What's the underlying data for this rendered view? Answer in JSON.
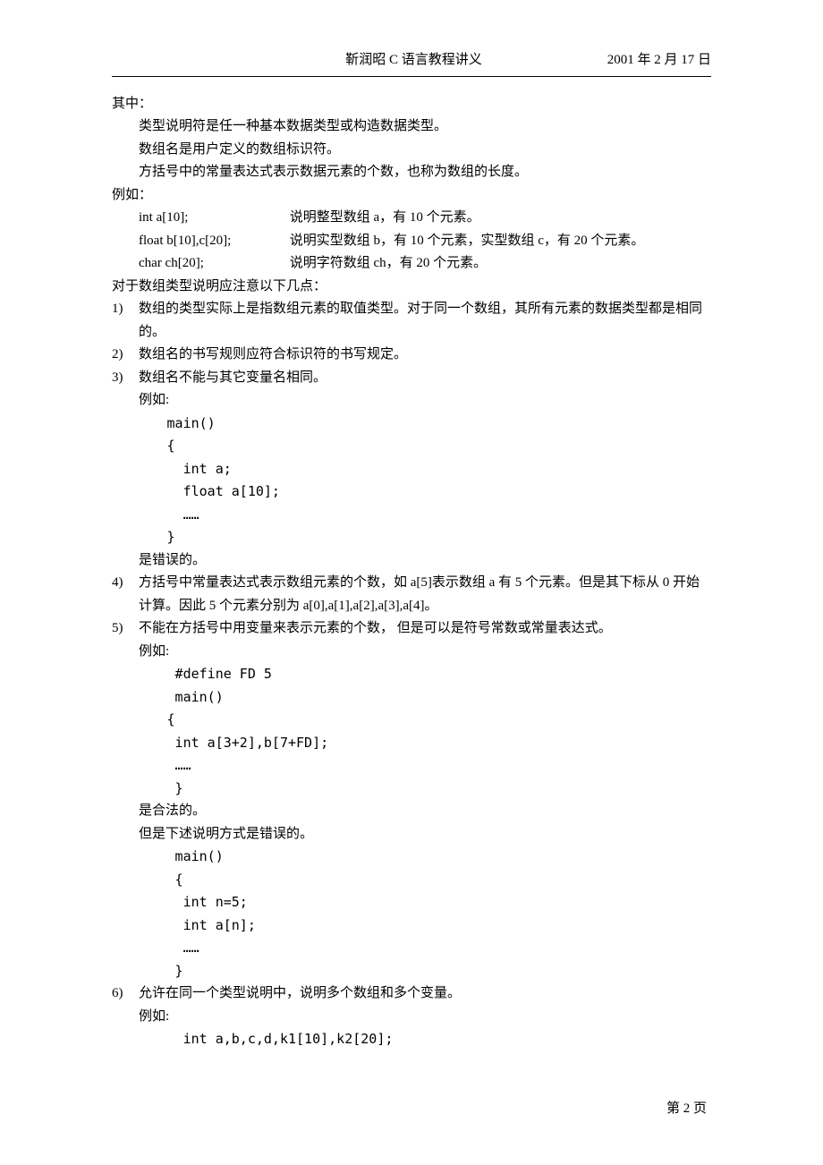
{
  "header": {
    "author_title": "靳润昭   C 语言教程讲义",
    "date": "2001 年 2 月 17 日"
  },
  "body": {
    "intro_label": "其中：",
    "intro_lines": [
      "类型说明符是任一种基本数据类型或构造数据类型。",
      "数组名是用户定义的数组标识符。",
      "方括号中的常量表达式表示数据元素的个数，也称为数组的长度。"
    ],
    "example_label": "例如：",
    "decl_rows": [
      {
        "code": "int a[10];",
        "desc": "说明整型数组 a，有 10 个元素。"
      },
      {
        "code": "float b[10],c[20];",
        "desc": "说明实型数组 b，有 10 个元素，实型数组 c，有 20 个元素。"
      },
      {
        "code": "char ch[20];",
        "desc": "说明字符数组 ch，有 20 个元素。"
      }
    ],
    "notice_heading": "对于数组类型说明应注意以下几点：",
    "points": {
      "p1": {
        "num": "1)",
        "text": "数组的类型实际上是指数组元素的取值类型。对于同一个数组，其所有元素的数据类型都是相同的。"
      },
      "p2": {
        "num": "2)",
        "text": "数组名的书写规则应符合标识符的书写规定。"
      },
      "p3": {
        "num": "3)",
        "text": "数组名不能与其它变量名相同。",
        "eg_label": "例如:",
        "code": " main()\n {\n   int a;\n   float a[10];\n   ……\n }",
        "tail": "是错误的。"
      },
      "p4": {
        "num": "4)",
        "text": "方括号中常量表达式表示数组元素的个数，如 a[5]表示数组 a 有 5 个元素。但是其下标从 0 开始计算。因此 5 个元素分别为 a[0],a[1],a[2],a[3],a[4]。"
      },
      "p5": {
        "num": "5)",
        "text": "不能在方括号中用变量来表示元素的个数， 但是可以是符号常数或常量表达式。",
        "eg_label": "例如:",
        "code1": "  #define FD 5\n  main()\n {\n  int a[3+2],b[7+FD];\n  ……\n  }",
        "mid1": "是合法的。",
        "mid2": "但是下述说明方式是错误的。",
        "code2": "  main()\n  {\n   int n=5;\n   int a[n];\n   ……\n  }"
      },
      "p6": {
        "num": "6)",
        "text": "允许在同一个类型说明中，说明多个数组和多个变量。",
        "eg_label": "例如:",
        "code": "   int a,b,c,d,k1[10],k2[20];"
      }
    }
  },
  "footer": {
    "page_label": "第 2 页"
  }
}
